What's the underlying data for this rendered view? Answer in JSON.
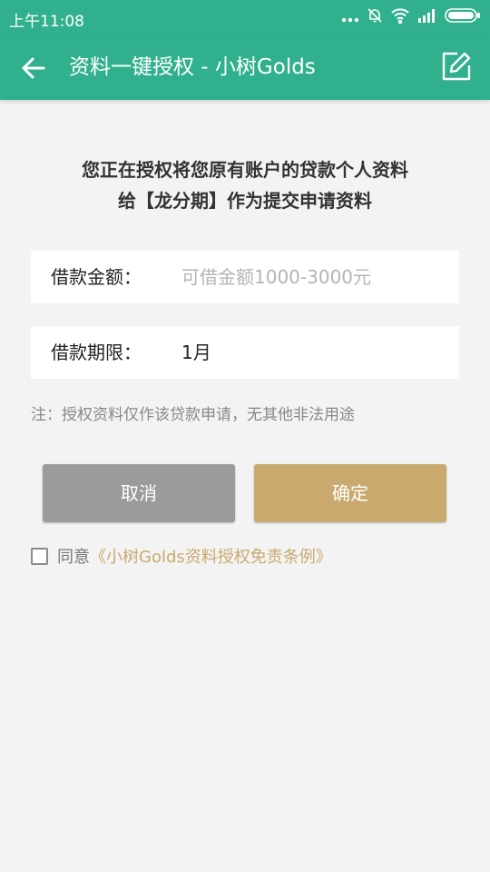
{
  "status_bar": {
    "time": "上午11:08"
  },
  "app_bar": {
    "title": "资料一键授权 - 小树Golds"
  },
  "headline": {
    "line1": "您正在授权将您原有账户的贷款个人资料",
    "line2": "给【龙分期】作为提交申请资料"
  },
  "form": {
    "amount_label": "借款金额：",
    "amount_placeholder": "可借金额1000-3000元",
    "amount_value": "",
    "term_label": "借款期限：",
    "term_value": "1月"
  },
  "note": "注：授权资料仅作该贷款申请，无其他非法用途",
  "buttons": {
    "cancel": "取消",
    "confirm": "确定"
  },
  "agreement": {
    "checked": false,
    "prefix": "同意",
    "link": "《小树Golds资料授权免责条例》"
  },
  "colors": {
    "primary": "#31b08e",
    "gold": "#c9a96e",
    "cancel_gray": "#9b9b9b",
    "background": "#f3f3f3"
  }
}
